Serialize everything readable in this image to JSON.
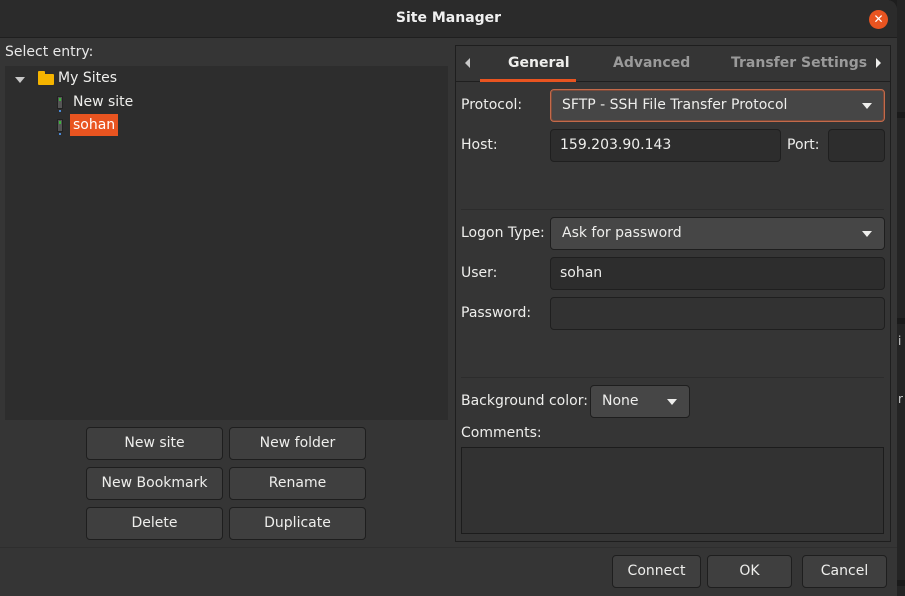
{
  "window": {
    "title": "Site Manager",
    "close_icon": "close-icon",
    "accent_color": "#e95420"
  },
  "left": {
    "select_label": "Select entry:",
    "tree": {
      "root": {
        "label": "My Sites",
        "icon": "folder-icon",
        "expanded": true
      },
      "children": [
        {
          "label": "New site",
          "icon": "server-icon",
          "selected": false
        },
        {
          "label": "sohan",
          "icon": "server-icon",
          "selected": true
        }
      ]
    },
    "buttons": {
      "new_site": "New site",
      "new_folder": "New folder",
      "new_bookmark": "New Bookmark",
      "rename": "Rename",
      "delete": "Delete",
      "duplicate": "Duplicate"
    }
  },
  "tabs": {
    "items": [
      {
        "label": "General",
        "active": true
      },
      {
        "label": "Advanced",
        "active": false
      },
      {
        "label": "Transfer Settings",
        "active": false
      }
    ]
  },
  "general": {
    "protocol_label": "Protocol:",
    "protocol_value": "SFTP - SSH File Transfer Protocol",
    "host_label": "Host:",
    "host_value": "159.203.90.143",
    "port_label": "Port:",
    "port_value": "",
    "logon_type_label": "Logon Type:",
    "logon_type_value": "Ask for password",
    "user_label": "User:",
    "user_value": "sohan",
    "password_label": "Password:",
    "password_value": "",
    "bg_color_label": "Background color:",
    "bg_color_value": "None",
    "comments_label": "Comments:",
    "comments_value": ""
  },
  "footer": {
    "connect": "Connect",
    "ok": "OK",
    "cancel": "Cancel"
  },
  "background_app": {
    "visible_chars": [
      "i",
      "r"
    ]
  }
}
